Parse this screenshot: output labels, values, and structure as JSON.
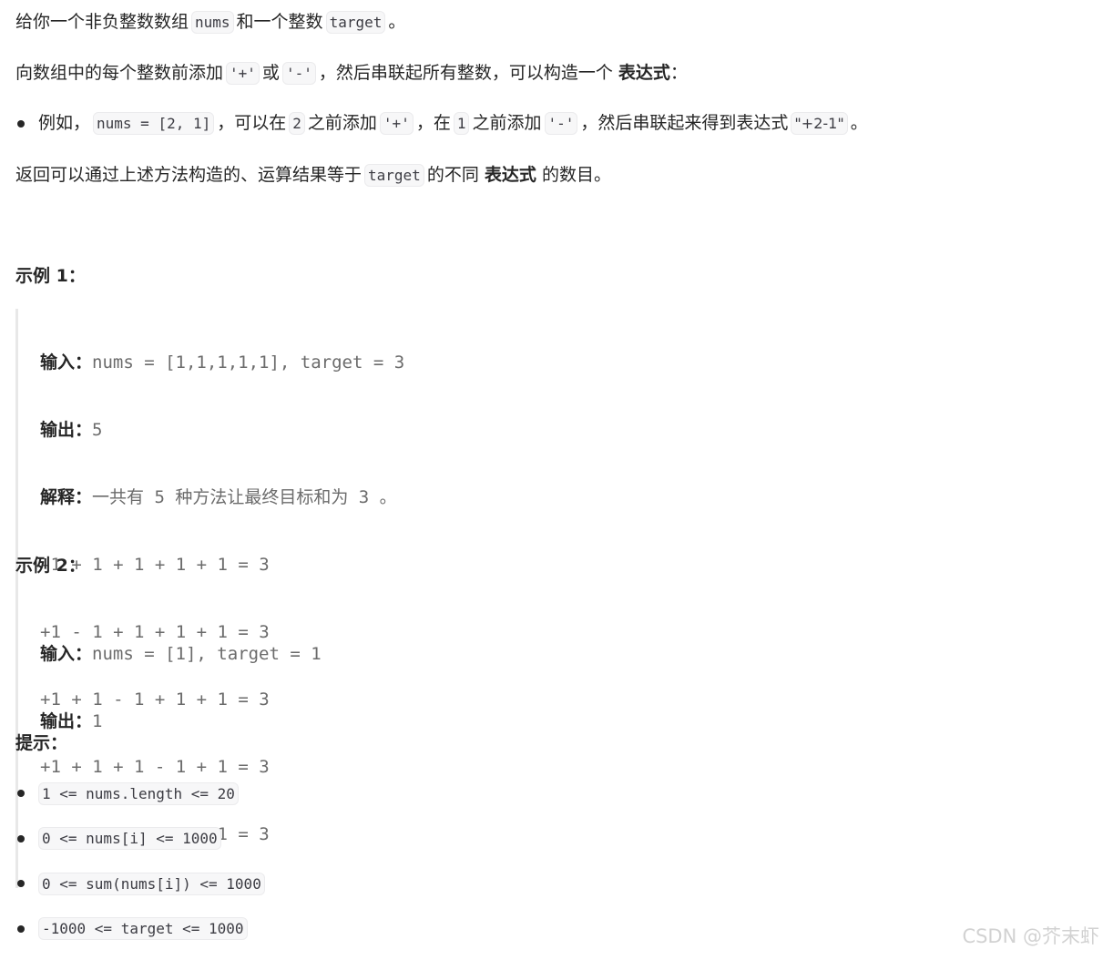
{
  "intro": {
    "p1": {
      "t1": "给你一个非负整数数组",
      "c1": "nums",
      "t2": "和一个整数",
      "c2": "target",
      "t3": "。"
    },
    "p2": {
      "t1": "向数组中的每个整数前添加",
      "c1": "'+'",
      "t2": "或",
      "c2": "'-'",
      "t3": "，然后串联起所有整数，可以构造一个",
      "b1": "表达式",
      "t4": "："
    },
    "bullet": {
      "t1": "例如，",
      "c1": "nums = [2, 1]",
      "t2": "，可以在",
      "c2": "2",
      "t3": "之前添加",
      "c3": "'+'",
      "t4": "，在",
      "c4": "1",
      "t5": "之前添加",
      "c5": "'-'",
      "t6": "，然后串联起来得到表达式",
      "c6": "\"+2-1\"",
      "t7": "。"
    },
    "p3": {
      "t1": "返回可以通过上述方法构造的、运算结果等于",
      "c1": "target",
      "t2": "的不同",
      "b1": "表达式",
      "t3": "的数目。"
    }
  },
  "example1": {
    "title": "示例 1：",
    "input_label": "输入：",
    "input_value": "nums = [1,1,1,1,1], target = 3",
    "output_label": "输出：",
    "output_value": "5",
    "explain_label": "解释：",
    "explain_value": "一共有 5 种方法让最终目标和为 3 。",
    "lines": [
      "-1 + 1 + 1 + 1 + 1 = 3",
      "+1 - 1 + 1 + 1 + 1 = 3",
      "+1 + 1 - 1 + 1 + 1 = 3",
      "+1 + 1 + 1 - 1 + 1 = 3",
      "+1 + 1 + 1 + 1 - 1 = 3"
    ]
  },
  "example2": {
    "title": "示例 2：",
    "input_label": "输入：",
    "input_value": "nums = [1], target = 1",
    "output_label": "输出：",
    "output_value": "1"
  },
  "tips": {
    "title": "提示：",
    "items": [
      "1 <= nums.length <= 20",
      "0 <= nums[i] <= 1000",
      "0 <= sum(nums[i]) <= 1000",
      "-1000 <= target <= 1000"
    ]
  },
  "watermark": "CSDN @芥末虾"
}
